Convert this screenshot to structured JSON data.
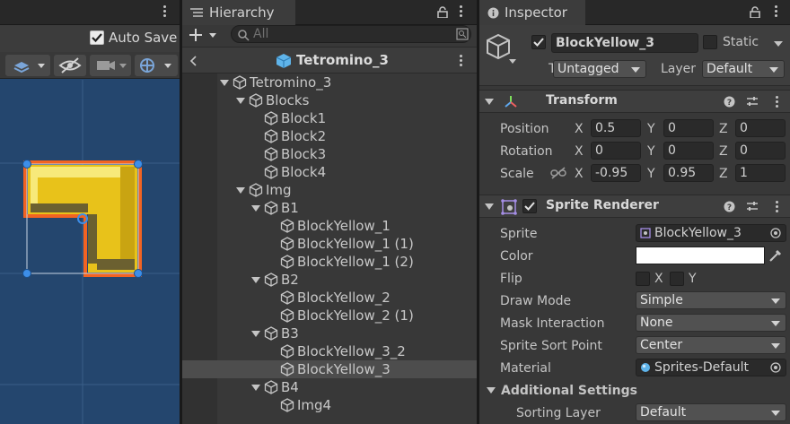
{
  "scene": {
    "auto_save_label": "Auto Save",
    "auto_save_checked": true
  },
  "hierarchy": {
    "tab_label": "Hierarchy",
    "search_placeholder": "All",
    "scene_title": "Tetromino_3",
    "rows": [
      {
        "label": "Tetromino_3",
        "depth": 0,
        "expanded": true
      },
      {
        "label": "Blocks",
        "depth": 1,
        "expanded": true
      },
      {
        "label": "Block1",
        "depth": 2
      },
      {
        "label": "Block2",
        "depth": 2
      },
      {
        "label": "Block3",
        "depth": 2
      },
      {
        "label": "Block4",
        "depth": 2
      },
      {
        "label": "Img",
        "depth": 1,
        "expanded": true
      },
      {
        "label": "B1",
        "depth": 2,
        "expanded": true
      },
      {
        "label": "BlockYellow_1",
        "depth": 3
      },
      {
        "label": "BlockYellow_1 (1)",
        "depth": 3
      },
      {
        "label": "BlockYellow_1 (2)",
        "depth": 3
      },
      {
        "label": "B2",
        "depth": 2,
        "expanded": true
      },
      {
        "label": "BlockYellow_2",
        "depth": 3
      },
      {
        "label": "BlockYellow_2 (1)",
        "depth": 3
      },
      {
        "label": "B3",
        "depth": 2,
        "expanded": true
      },
      {
        "label": "BlockYellow_3_2",
        "depth": 3
      },
      {
        "label": "BlockYellow_3",
        "depth": 3,
        "selected": true
      },
      {
        "label": "B4",
        "depth": 2,
        "expanded": true
      },
      {
        "label": "Img4",
        "depth": 3
      }
    ]
  },
  "inspector": {
    "tab_label": "Inspector",
    "object_name": "BlockYellow_3",
    "active": true,
    "static_label": "Static",
    "tag_label": "Tag",
    "tag_value": "Untagged",
    "layer_label": "Layer",
    "layer_value": "Default",
    "transform": {
      "title": "Transform",
      "position_label": "Position",
      "rotation_label": "Rotation",
      "scale_label": "Scale",
      "position": {
        "x": "0.5",
        "y": "0",
        "z": "0"
      },
      "rotation": {
        "x": "0",
        "y": "0",
        "z": "0"
      },
      "scale": {
        "x": "-0.95",
        "y": "0.95",
        "z": "1"
      },
      "axis_x": "X",
      "axis_y": "Y",
      "axis_z": "Z"
    },
    "sprite_renderer": {
      "title": "Sprite Renderer",
      "enabled": true,
      "sprite_label": "Sprite",
      "sprite_value": "BlockYellow_3",
      "color_label": "Color",
      "color_value": "#ffffff",
      "flip_label": "Flip",
      "flip_x": "X",
      "flip_y": "Y",
      "draw_mode_label": "Draw Mode",
      "draw_mode_value": "Simple",
      "mask_label": "Mask Interaction",
      "mask_value": "None",
      "sort_point_label": "Sprite Sort Point",
      "sort_point_value": "Center",
      "material_label": "Material",
      "material_value": "Sprites-Default",
      "additional_label": "Additional Settings",
      "sorting_layer_label": "Sorting Layer",
      "sorting_layer_value": "Default"
    }
  },
  "colors": {
    "accent_orange": "#f26322",
    "sprite_yellow": "#e8c21a",
    "handle_blue": "#3d8ee8",
    "scene_bg": "#24466e"
  }
}
